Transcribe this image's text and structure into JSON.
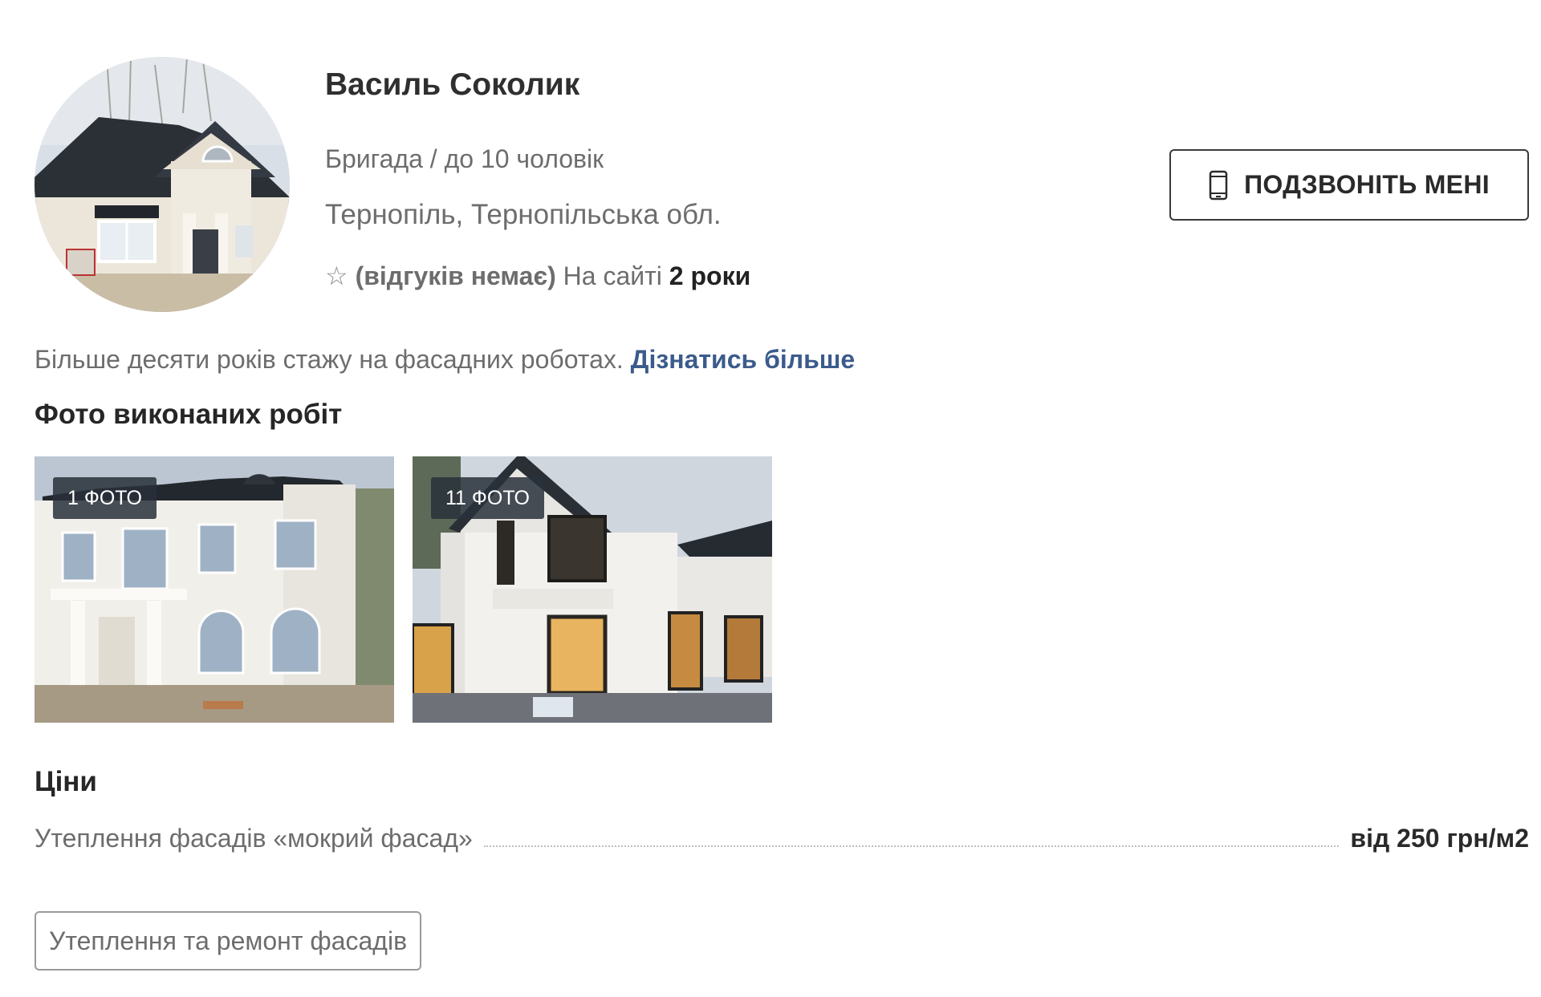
{
  "profile": {
    "name": "Василь Соколик",
    "team": "Бригада / до 10 чоловік",
    "location": "Тернопіль, Тернопільська обл.",
    "rating_star": "☆",
    "reviews": "(відгуків немає)",
    "on_site_label": "На сайті",
    "on_site_value": "2 роки"
  },
  "call_button": {
    "label": "ПОДЗВОНІТЬ МЕНІ",
    "icon": "phone-icon"
  },
  "about": {
    "text": "Більше десяти років стажу на фасадних роботах.",
    "link": "Дізнатись більше",
    "link_color": "#3b5b8c"
  },
  "photos": {
    "title": "Фото виконаних робіт",
    "items": [
      {
        "badge": "1 ФОТО"
      },
      {
        "badge": "11 ФОТО"
      }
    ]
  },
  "prices": {
    "title": "Ціни",
    "items": [
      {
        "service": "Утеплення фасадів «мокрий фасад»",
        "price": "від 250 грн/м2"
      }
    ]
  },
  "tags": [
    "Утеплення та ремонт фасадів"
  ]
}
